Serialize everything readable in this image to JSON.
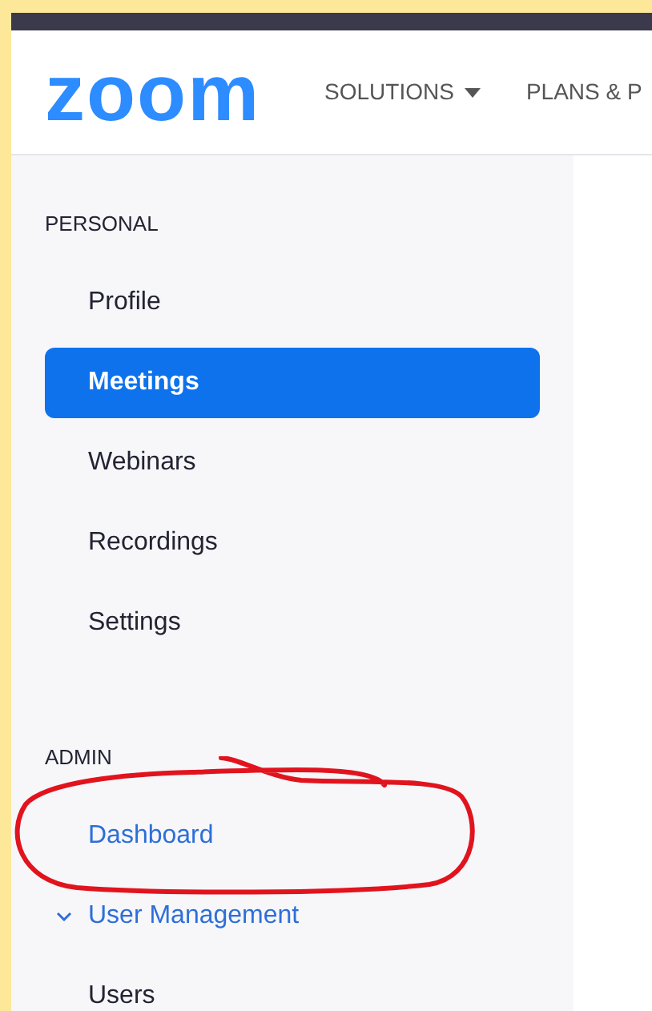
{
  "header": {
    "logo": "zoom",
    "nav": [
      {
        "label": "SOLUTIONS",
        "dropdown": true
      },
      {
        "label": "PLANS & P",
        "dropdown": false
      }
    ]
  },
  "sidebar": {
    "sections": [
      {
        "title": "PERSONAL",
        "items": [
          {
            "label": "Profile",
            "selected": false,
            "highlighted": false,
            "circled": false
          },
          {
            "label": "Meetings",
            "selected": true,
            "highlighted": false,
            "circled": false
          },
          {
            "label": "Webinars",
            "selected": false,
            "highlighted": false,
            "circled": false
          },
          {
            "label": "Recordings",
            "selected": false,
            "highlighted": false,
            "circled": false
          },
          {
            "label": "Settings",
            "selected": false,
            "highlighted": false,
            "circled": false
          }
        ]
      },
      {
        "title": "ADMIN",
        "items": [
          {
            "label": "Dashboard",
            "selected": false,
            "highlighted": true,
            "circled": true
          },
          {
            "label": "User Management",
            "selected": false,
            "highlighted": true,
            "circled": false,
            "expanded": true,
            "children": [
              {
                "label": "Users",
                "selected": false,
                "highlighted": false,
                "circled": false
              }
            ]
          }
        ]
      }
    ]
  }
}
